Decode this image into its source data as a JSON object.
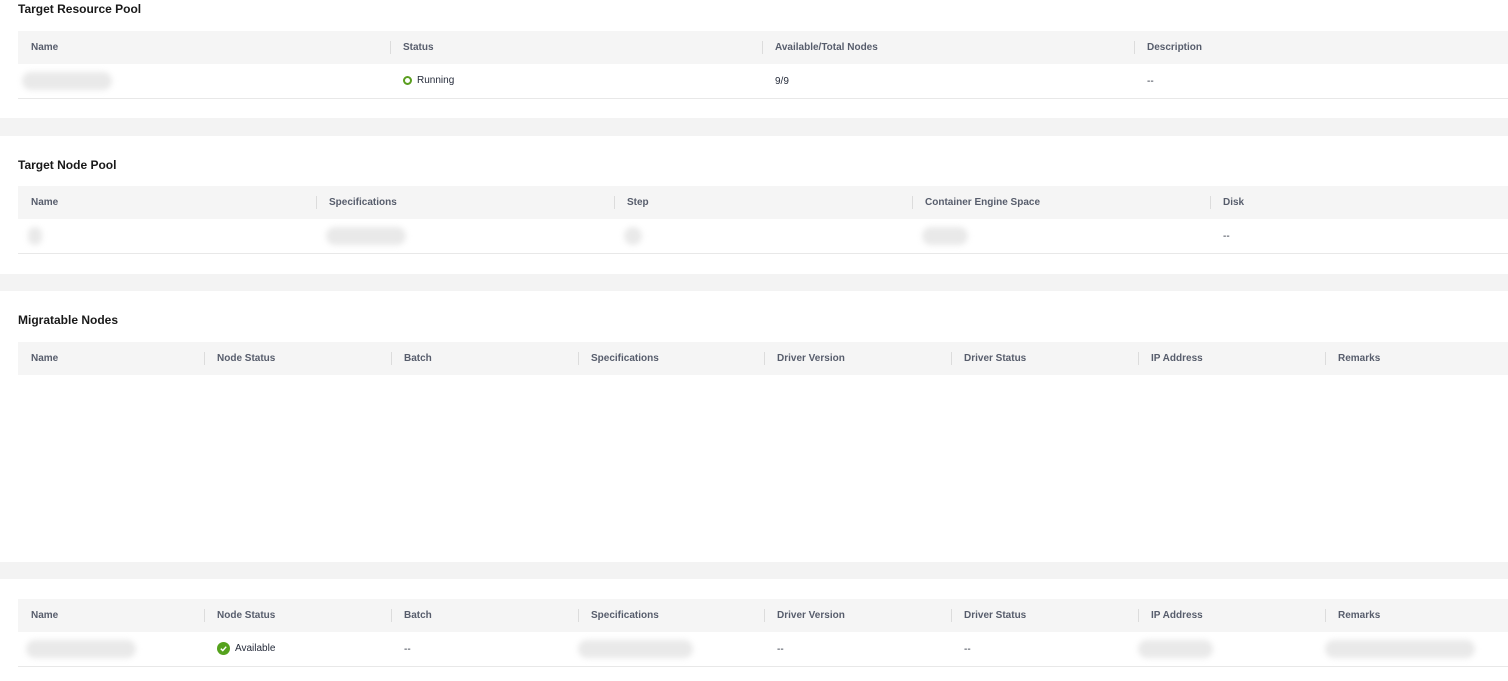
{
  "resource_pool": {
    "title": "Target Resource Pool",
    "columns": [
      "Name",
      "Status",
      "Available/Total Nodes",
      "Description"
    ],
    "row": {
      "status": "Running",
      "nodes": "9/9",
      "description": "--"
    }
  },
  "node_pool": {
    "title": "Target Node Pool",
    "columns": [
      "Name",
      "Specifications",
      "Step",
      "Container Engine Space",
      "Disk"
    ],
    "row": {
      "disk": "--"
    }
  },
  "migratable": {
    "title": "Migratable Nodes",
    "columns": [
      "Name",
      "Node Status",
      "Batch",
      "Specifications",
      "Driver Version",
      "Driver Status",
      "IP Address",
      "Remarks"
    ]
  },
  "selected": {
    "columns": [
      "Name",
      "Node Status",
      "Batch",
      "Specifications",
      "Driver Version",
      "Driver Status",
      "IP Address",
      "Remarks"
    ],
    "row": {
      "status": "Available",
      "batch": "--",
      "driver_version": "--",
      "driver_status": "--"
    }
  },
  "colors": {
    "running": "#5a9e1f",
    "available": "#55a21d"
  }
}
